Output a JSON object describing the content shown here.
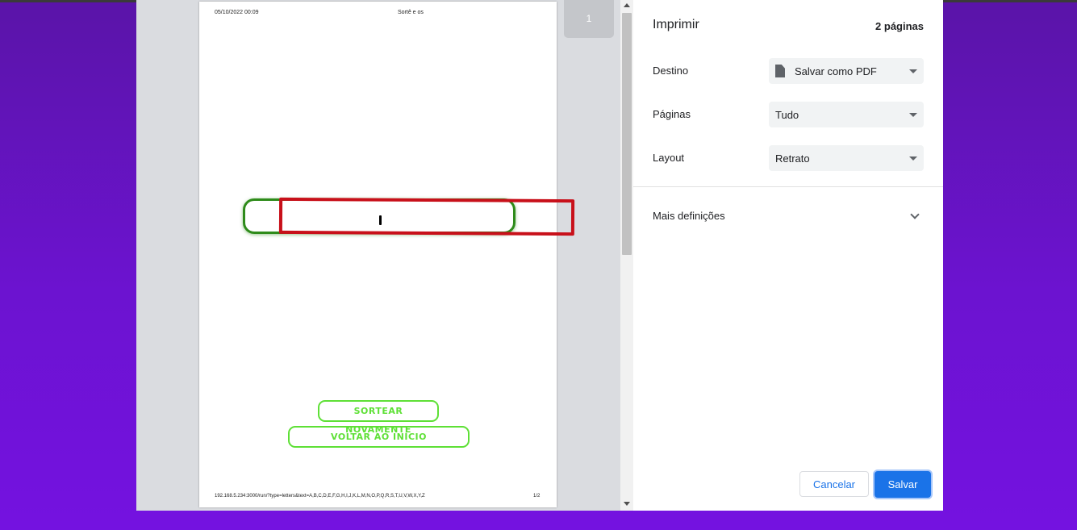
{
  "preview": {
    "header_date": "05/10/2022 00:09",
    "header_title": "Sortê e os",
    "button_again": "SORTEAR NOVAMENTE",
    "button_home": "VOLTAR AO INÍCIO",
    "footer_url": "192.168.5.234:3000/run/?type=letters&text=A,B,C,D,E,F,G,H,I,J,K,L,M,N,O,P,Q,R,S,T,U,V,W,X,Y,Z",
    "footer_page": "1/2",
    "thumbnail_number": "1"
  },
  "settings": {
    "title": "Imprimir",
    "page_count": "2 páginas",
    "destination_label": "Destino",
    "destination_value": "Salvar como PDF",
    "pages_label": "Páginas",
    "pages_value": "Tudo",
    "layout_label": "Layout",
    "layout_value": "Retrato",
    "more_settings": "Mais definições"
  },
  "actions": {
    "cancel": "Cancelar",
    "save": "Salvar"
  },
  "colors": {
    "accent": "#1a73e8",
    "highlight_frame": "#c8101a",
    "preview_green": "#2e8b1a",
    "preview_button_green": "#5ee036",
    "background_purple": "#6c13d0"
  },
  "icons": {
    "destination": "document-icon",
    "dropdown": "caret-down-icon",
    "expand": "chevron-down-icon"
  }
}
